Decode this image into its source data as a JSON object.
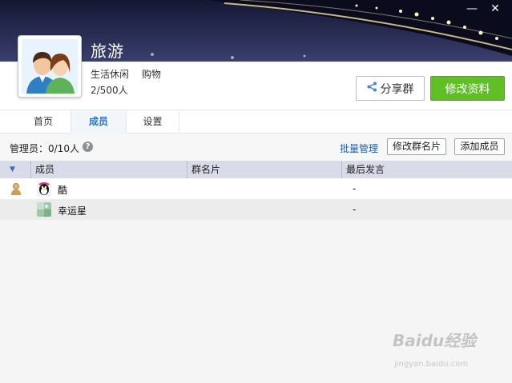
{
  "window": {
    "minimize_glyph": "—",
    "close_glyph": "✕"
  },
  "group": {
    "name": "旅游",
    "tags": [
      "生活休闲",
      "购物"
    ],
    "member_count": "2/500人"
  },
  "actions": {
    "share_label": "分享群",
    "edit_label": "修改资料",
    "share_icon": "share-icon"
  },
  "tabs": [
    {
      "label": "首页",
      "active": false
    },
    {
      "label": "成员",
      "active": true
    },
    {
      "label": "设置",
      "active": false
    }
  ],
  "admin_bar": {
    "admin_text": "管理员：0/10人",
    "help_glyph": "?",
    "batch_manage": "批量管理",
    "edit_card_button": "修改群名片",
    "add_member_button": "添加成员"
  },
  "table": {
    "columns": [
      "成员",
      "群名片",
      "最后发言"
    ],
    "sort_glyph": "▼",
    "rows": [
      {
        "name": "酷",
        "card": "",
        "last_speak": "-",
        "role_icon": "owner-icon",
        "avatar": "penguin-avatar"
      },
      {
        "name": "幸运星",
        "card": "",
        "last_speak": "-",
        "role_icon": "",
        "avatar": "landscape-avatar"
      }
    ]
  },
  "watermark": {
    "brand": "Baidu经验",
    "url": "jingyan.baidu.com"
  },
  "colors": {
    "accent_green": "#5fbf24",
    "link_blue": "#1f5fae",
    "header_row": "#d8dbe8"
  }
}
